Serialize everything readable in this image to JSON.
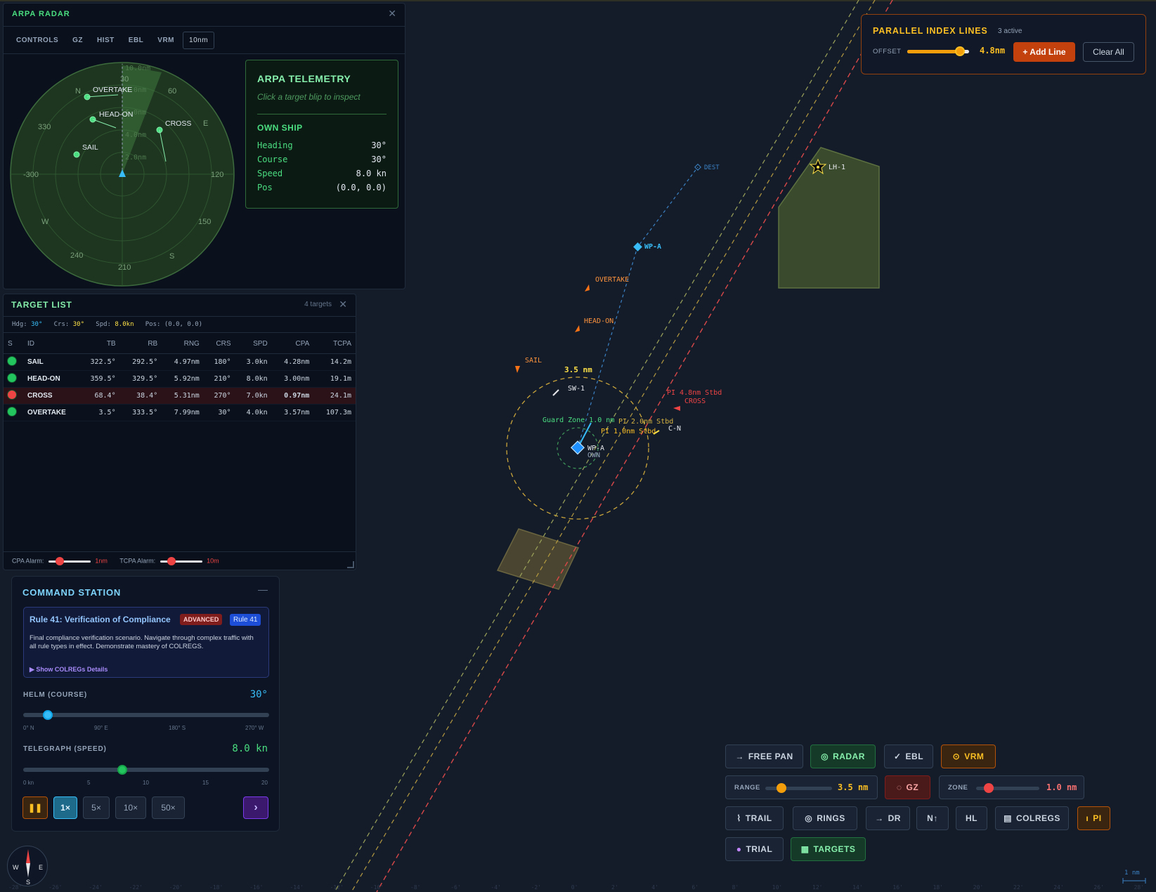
{
  "radar": {
    "title": "ARPA RADAR",
    "tabs": [
      "CONTROLS",
      "GZ",
      "HIST",
      "EBL",
      "VRM",
      "10nm"
    ],
    "bearing_labels": [
      "30",
      "60",
      "E",
      "120",
      "150",
      "S",
      "210",
      "240",
      "W",
      "-300",
      "330",
      "N"
    ],
    "range_labels": [
      "10.0nm",
      "8.0nm",
      "6.0nm",
      "4.0nm",
      "2.0nm"
    ],
    "blips": [
      "OVERTAKE",
      "HEAD-ON",
      "CROSS",
      "SAIL"
    ]
  },
  "telemetry": {
    "title": "ARPA TELEMETRY",
    "hint": "Click a target blip to inspect",
    "own_ship_label": "OWN SHIP",
    "rows": [
      {
        "k": "Heading",
        "v": "30°"
      },
      {
        "k": "Course",
        "v": "30°"
      },
      {
        "k": "Speed",
        "v": "8.0 kn"
      },
      {
        "k": "Pos",
        "v": "(0.0, 0.0)"
      }
    ]
  },
  "target_list": {
    "title": "TARGET LIST",
    "count": "4 targets",
    "summary": {
      "hdg_label": "Hdg:",
      "hdg": "30°",
      "crs_label": "Crs:",
      "crs": "30°",
      "spd_label": "Spd:",
      "spd": "8.0kn",
      "pos_label": "Pos:",
      "pos": "(0.0, 0.0)"
    },
    "columns": [
      "S",
      "ID",
      "TB",
      "RB",
      "RNG",
      "CRS",
      "SPD",
      "CPA",
      "TCPA"
    ],
    "rows": [
      {
        "status": "green",
        "id": "SAIL",
        "tb": "322.5°",
        "rb": "292.5°",
        "rng": "4.97nm",
        "crs": "180°",
        "spd": "3.0kn",
        "cpa": "4.28nm",
        "tcpa": "14.2m"
      },
      {
        "status": "green",
        "id": "HEAD-ON",
        "tb": "359.5°",
        "rb": "329.5°",
        "rng": "5.92nm",
        "crs": "210°",
        "spd": "8.0kn",
        "cpa": "3.00nm",
        "tcpa": "19.1m"
      },
      {
        "status": "red",
        "id": "CROSS",
        "tb": "68.4°",
        "rb": "38.4°",
        "rng": "5.31nm",
        "crs": "270°",
        "spd": "7.0kn",
        "cpa": "0.97nm",
        "tcpa": "24.1m"
      },
      {
        "status": "green",
        "id": "OVERTAKE",
        "tb": "3.5°",
        "rb": "333.5°",
        "rng": "7.99nm",
        "crs": "30°",
        "spd": "4.0kn",
        "cpa": "3.57nm",
        "tcpa": "107.3m"
      }
    ],
    "cpa_alarm_label": "CPA Alarm:",
    "cpa_alarm_value": "1nm",
    "tcpa_alarm_label": "TCPA Alarm:",
    "tcpa_alarm_value": "10m"
  },
  "command": {
    "title": "COMMAND STATION",
    "minimize": "—",
    "rule_title": "Rule 41: Verification of Compliance",
    "badge_level": "ADVANCED",
    "badge_rule": "Rule 41",
    "rule_desc": "Final compliance verification scenario. Navigate through complex traffic with all rule types in effect. Demonstrate mastery of COLREGS.",
    "show_details": "▶ Show COLREGs Details",
    "helm_label": "HELM (COURSE)",
    "helm_value": "30°",
    "helm_fraction": 0.083,
    "helm_ticks": [
      "0° N",
      "90° E",
      "180° S",
      "270° W"
    ],
    "telegraph_label": "TELEGRAPH (SPEED)",
    "telegraph_value": "8.0 kn",
    "telegraph_fraction": 0.4,
    "telegraph_ticks": [
      "0 kn",
      "5",
      "10",
      "15",
      "20"
    ],
    "pause_icon": "❚❚",
    "speeds": [
      "1×",
      "5×",
      "10×",
      "50×"
    ],
    "next_icon": "›"
  },
  "pi_panel": {
    "title": "PARALLEL INDEX LINES",
    "active": "3 active",
    "offset_label": "OFFSET",
    "offset_value": "4.8nm",
    "offset_fraction": 0.92,
    "add_label": "+ Add Line",
    "clear_label": "Clear All"
  },
  "toolbar": {
    "free_pan": "FREE PAN",
    "radar": "RADAR",
    "ebl": "EBL",
    "vrm": "VRM",
    "range_label": "RANGE",
    "range_value": "3.5 nm",
    "range_fraction": 0.2,
    "gz": "GZ",
    "zone_label": "ZONE",
    "zone_value": "1.0 nm",
    "zone_fraction": 0.15,
    "trail": "TRAIL",
    "rings": "RINGS",
    "dr": "DR",
    "north_up": "N↑",
    "hl": "HL",
    "colregs": "COLREGS",
    "pi": "PI",
    "trial": "TRIAL",
    "targets": "TARGETS"
  },
  "map_labels": {
    "dest": "DEST",
    "lighthouse": "LH-1",
    "wp_a": "WP-A",
    "overtake": "OVERTAKE",
    "head_on": "HEAD-ON",
    "sail": "SAIL",
    "vrm_range": "3.5 nm",
    "sw1": "SW-1",
    "pi_48": "PI 4.8nm Stbd",
    "cross": "CROSS",
    "guard_zone": "Guard Zone 1.0 nm",
    "pi_20": "PI 2.0nm Stbd",
    "pi_10": "PI 1.0nm Stbd",
    "cn": "C-N",
    "wp_a2": "WP-A",
    "own": "OWN",
    "scale": "1 nm",
    "x_ticks": [
      "-28'",
      "-26'",
      "-24'",
      "-22'",
      "-20'",
      "-18'",
      "-16'",
      "-14'",
      "-12'",
      "-10'",
      "-8'",
      "-6'",
      "-4'",
      "-2'",
      "0'",
      "2'",
      "4'",
      "6'",
      "8'",
      "10'",
      "12'",
      "14'",
      "16'",
      "18'",
      "20'",
      "22'",
      "24'",
      "26'",
      "28'"
    ]
  },
  "compass": {
    "n": "N",
    "e": "E",
    "s": "S",
    "w": "W"
  },
  "colors": {
    "accent_green": "#4ade80",
    "pi_orange": "#fbbf24",
    "danger": "#ef4444",
    "own_ship": "#38bdf8"
  }
}
